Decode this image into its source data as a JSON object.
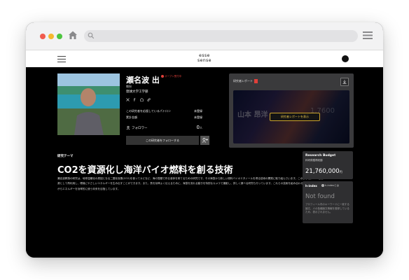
{
  "browser": {
    "colors": {
      "close": "#f15b4e",
      "minimize": "#f5b82e",
      "maximize": "#4dc53f"
    },
    "icons": [
      "home-icon",
      "search-icon",
      "menu-icon"
    ],
    "url": ""
  },
  "site": {
    "logo_line1": "esse",
    "logo_line2": "sense",
    "icons": [
      "hamburger-icon",
      "account-icon"
    ]
  },
  "profile": {
    "name": "瀬名波 出",
    "badge": "オープン受付中",
    "title": "教授",
    "affiliation": "琉球大学工学部",
    "social_icons": [
      "x-icon",
      "facebook-icon",
      "website-icon",
      "link-icon"
    ],
    "stats": [
      {
        "label": "この研究者を応援しているパトロン",
        "value": "未登録"
      },
      {
        "label": "累計金額",
        "value": "未登録"
      }
    ],
    "follower_label": "フォロワー",
    "follower_count": "0",
    "follower_unit": "人",
    "follow_button": "この研究者をフォローする"
  },
  "report": {
    "title": "研究者レポート",
    "preview_name": "山本 昂洋",
    "preview_number": "1,7600",
    "view_button": "研究者レポートを表示",
    "accent": "#c9a22b"
  },
  "research": {
    "theme_label": "研究テーマ",
    "theme_title": "CO2を資源化し海洋バイオ燃料を創る技術",
    "description": "瀬名波教授の研究は、地球温暖化の原因となる二酸化炭素(CO2)を使ってカビなど、海の藻類で作る液体を育てるための研究です。その海藻から新しい燃料バイオエタノールを得る技術の開発に取り組んでいます。このように、CO2を資源として再利用し、環境にやさしいエネルギーを生み出すことができます。また、熱を効率よく伝えるために、海藻を流れる動きを特別なカメラで撮影し、詳しく調べる研究も行っています。これらの技術を組み合わせて、環境を守りながらエネルギーを効率的に使う未来を目指しています。"
  },
  "budget": {
    "title": "Research Budget",
    "subtitle": "科研費獲得総額",
    "amount": "21,760,000",
    "unit": "円"
  },
  "hindex": {
    "title": "h-index",
    "help": "h-indexとは",
    "value": "Not found",
    "note": "プロフィール内のキーワードに一致する論文、人の各種論文情報を登録しているため、表示されません。"
  }
}
